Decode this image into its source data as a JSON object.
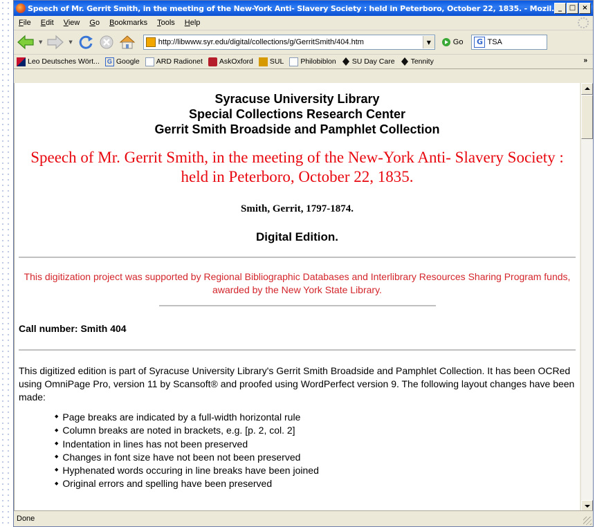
{
  "window": {
    "title": "Speech of Mr. Gerrit Smith, in the meeting of the New-York Anti- Slavery Society : held in Peterboro, October 22, 1835. - Mozil...",
    "controls": [
      "_",
      "□",
      "×"
    ]
  },
  "menu": [
    "File",
    "Edit",
    "View",
    "Go",
    "Bookmarks",
    "Tools",
    "Help"
  ],
  "navbar": {
    "url": "http://libwww.syr.edu/digital/collections/g/GerritSmith/404.htm",
    "go_label": "Go",
    "search_value": "TSA"
  },
  "bookmarks": [
    {
      "label": "Leo Deutsches Wört...",
      "icon": "flag-icon"
    },
    {
      "label": "Google",
      "icon": "google-icon"
    },
    {
      "label": "ARD Radionet",
      "icon": "page-icon"
    },
    {
      "label": "AskOxford",
      "icon": "askoxford-icon"
    },
    {
      "label": "SUL",
      "icon": "sul-icon"
    },
    {
      "label": "Philobiblon",
      "icon": "page-icon"
    },
    {
      "label": "SU Day Care",
      "icon": "diamond-icon"
    },
    {
      "label": "Tennity",
      "icon": "diamond-icon"
    }
  ],
  "bookmarks_more": "»",
  "page": {
    "header_lines": [
      "Syracuse University Library",
      "Special Collections Research Center",
      "Gerrit Smith Broadside and Pamphlet Collection"
    ],
    "title": "Speech of Mr. Gerrit Smith, in the meeting of the New-York Anti- Slavery Society : held in Peterboro, October 22, 1835.",
    "author": "Smith, Gerrit, 1797-1874.",
    "edition": "Digital Edition.",
    "support": "This digitization project was supported by Regional Bibliographic Databases and Interlibrary Resources Sharing Program funds, awarded by the New York State Library.",
    "call_number": "Call number: Smith 404",
    "intro": "This digitized edition is part of Syracuse University Library's Gerrit Smith Broadside and Pamphlet Collection. It has been OCRed using OmniPage Pro, version 11 by Scansoft® and proofed using WordPerfect version 9. The following layout changes have been made:",
    "notes": [
      "Page breaks are indicated by a full-width horizontal rule",
      "Column breaks are noted in brackets, e.g. [p. 2, col. 2]",
      "Indentation in lines has not been preserved",
      "Changes in font size have not been not been preserved",
      "Hyphenated words occuring in line breaks have been joined",
      "Original errors and spelling have been preserved"
    ]
  },
  "status": "Done",
  "colors": {
    "title_red": "#e8080f",
    "support_red": "#d3252b",
    "titlebar_blue": "#0a58e0"
  }
}
